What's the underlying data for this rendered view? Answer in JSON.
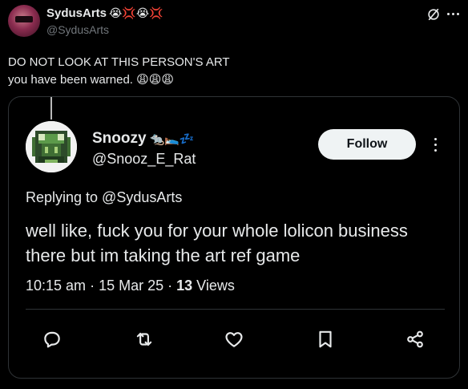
{
  "outer_tweet": {
    "author_name": "SydusArts",
    "author_emojis": "😭💢😭💢",
    "handle": "@SydusArts",
    "text_lines": [
      "DO NOT LOOK AT THIS PERSON'S ART",
      "you have been warned. 😩😩😩"
    ]
  },
  "quoted_tweet": {
    "author_name": "Snoozy",
    "author_emojis": "🐀🛌💤",
    "handle": "@Snooz_E_Rat",
    "follow_label": "Follow",
    "replying_to": "Replying to @SydusArts",
    "text_lines": [
      "well like, fuck you for your whole lolicon business",
      "there but im taking the art ref game"
    ],
    "time": "10:15 am",
    "date": "15 Mar 25",
    "views_count": "13",
    "views_label": "Views",
    "separator": "·"
  },
  "icons": {
    "grok": "grok-icon",
    "more": "more-icon",
    "actions": [
      "reply-icon",
      "retweet-icon",
      "like-icon",
      "bookmark-icon",
      "share-icon"
    ]
  },
  "colors": {
    "background": "#000000",
    "text": "#e7e9ea",
    "secondary_text": "#71767b",
    "border": "#2f3336",
    "follow_bg": "#eff3f4",
    "follow_text": "#0f1419",
    "action_icon": "#e7e9ea"
  }
}
